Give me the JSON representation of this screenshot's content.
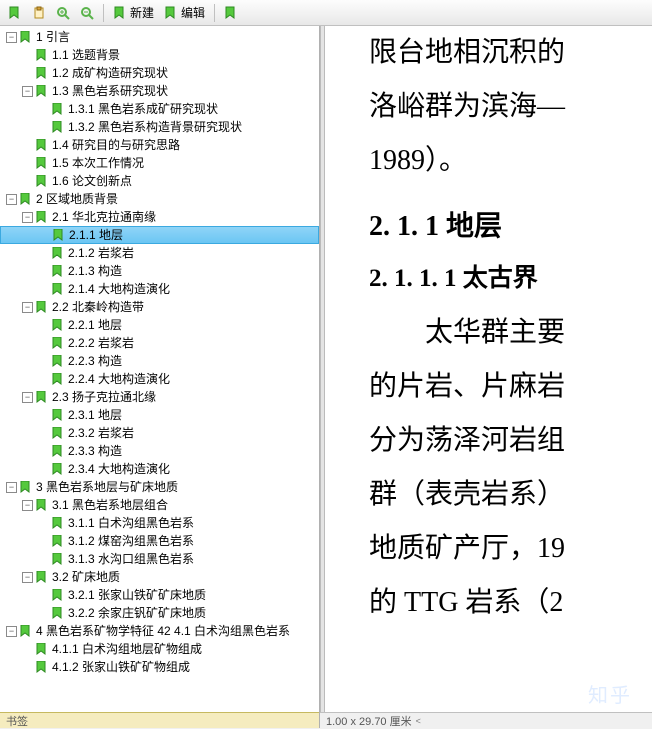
{
  "toolbar": {
    "new_label": "新建",
    "edit_label": "编辑"
  },
  "sidebar": {
    "tab_label": "书签",
    "selected_path": "2.1.1 地层",
    "tree": [
      {
        "depth": 0,
        "twisty": "minus",
        "label": "1 引言"
      },
      {
        "depth": 1,
        "twisty": "none",
        "label": "1.1 选题背景"
      },
      {
        "depth": 1,
        "twisty": "none",
        "label": "1.2 成矿构造研究现状"
      },
      {
        "depth": 1,
        "twisty": "minus",
        "label": "1.3 黑色岩系研究现状"
      },
      {
        "depth": 2,
        "twisty": "none",
        "label": "1.3.1 黑色岩系成矿研究现状"
      },
      {
        "depth": 2,
        "twisty": "none",
        "label": "1.3.2 黑色岩系构造背景研究现状"
      },
      {
        "depth": 1,
        "twisty": "none",
        "label": "1.4 研究目的与研究思路"
      },
      {
        "depth": 1,
        "twisty": "none",
        "label": "1.5 本次工作情况"
      },
      {
        "depth": 1,
        "twisty": "none",
        "label": "1.6 论文创新点"
      },
      {
        "depth": 0,
        "twisty": "minus",
        "label": "2 区域地质背景"
      },
      {
        "depth": 1,
        "twisty": "minus",
        "label": "2.1 华北克拉通南缘"
      },
      {
        "depth": 2,
        "twisty": "none",
        "label": "2.1.1 地层",
        "selected": true
      },
      {
        "depth": 2,
        "twisty": "none",
        "label": "2.1.2 岩浆岩"
      },
      {
        "depth": 2,
        "twisty": "none",
        "label": "2.1.3 构造"
      },
      {
        "depth": 2,
        "twisty": "none",
        "label": "2.1.4 大地构造演化"
      },
      {
        "depth": 1,
        "twisty": "minus",
        "label": "2.2 北秦岭构造带"
      },
      {
        "depth": 2,
        "twisty": "none",
        "label": "2.2.1 地层"
      },
      {
        "depth": 2,
        "twisty": "none",
        "label": "2.2.2 岩浆岩"
      },
      {
        "depth": 2,
        "twisty": "none",
        "label": "2.2.3 构造"
      },
      {
        "depth": 2,
        "twisty": "none",
        "label": "2.2.4 大地构造演化"
      },
      {
        "depth": 1,
        "twisty": "minus",
        "label": "2.3 扬子克拉通北缘"
      },
      {
        "depth": 2,
        "twisty": "none",
        "label": "2.3.1 地层"
      },
      {
        "depth": 2,
        "twisty": "none",
        "label": "2.3.2 岩浆岩"
      },
      {
        "depth": 2,
        "twisty": "none",
        "label": "2.3.3 构造"
      },
      {
        "depth": 2,
        "twisty": "none",
        "label": "2.3.4 大地构造演化"
      },
      {
        "depth": 0,
        "twisty": "minus",
        "label": "3 黑色岩系地层与矿床地质"
      },
      {
        "depth": 1,
        "twisty": "minus",
        "label": "3.1 黑色岩系地层组合"
      },
      {
        "depth": 2,
        "twisty": "none",
        "label": "3.1.1 白术沟组黑色岩系"
      },
      {
        "depth": 2,
        "twisty": "none",
        "label": "3.1.2 煤窑沟组黑色岩系"
      },
      {
        "depth": 2,
        "twisty": "none",
        "label": "3.1.3 水沟口组黑色岩系"
      },
      {
        "depth": 1,
        "twisty": "minus",
        "label": "3.2 矿床地质"
      },
      {
        "depth": 2,
        "twisty": "none",
        "label": "3.2.1 张家山铁矿矿床地质"
      },
      {
        "depth": 2,
        "twisty": "none",
        "label": "3.2.2 余家庄钒矿矿床地质"
      },
      {
        "depth": 0,
        "twisty": "minus",
        "label": "4 黑色岩系矿物学特征 42 4.1 白术沟组黑色岩系"
      },
      {
        "depth": 1,
        "twisty": "none",
        "label": "4.1.1 白术沟组地层矿物组成"
      },
      {
        "depth": 1,
        "twisty": "none",
        "label": "4.1.2 张家山铁矿矿物组成"
      }
    ]
  },
  "content": {
    "line1": "限台地相沉积的",
    "line2": "洛峪群为滨海—",
    "line3": "1989）。",
    "heading2": "2. 1. 1  地层",
    "heading3": "2. 1. 1. 1  太古界",
    "para1": "　　太华群主要",
    "para2": "的片岩、片麻岩",
    "para3": "分为荡泽河岩组",
    "para4": "群（表壳岩系）",
    "para5": "地质矿产厅，19",
    "para6": "的 TTG 岩系（2"
  },
  "statusbar": {
    "text": "1.00 x 29.70 厘米"
  },
  "watermark": "知乎"
}
